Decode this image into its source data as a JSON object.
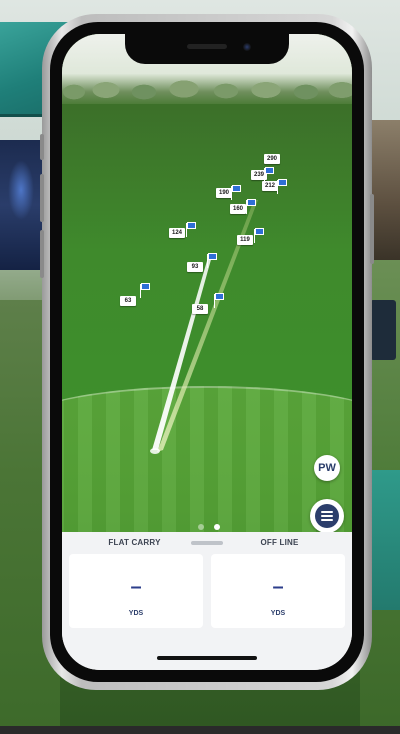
{
  "app": {
    "club_button": "PW",
    "menu_icon": "hamburger-menu-icon",
    "page_indicator": {
      "count": 2,
      "active": 1
    }
  },
  "range": {
    "target_distances": [
      {
        "label": "290"
      },
      {
        "label": "239"
      },
      {
        "label": "212"
      },
      {
        "label": "190"
      },
      {
        "label": "160"
      },
      {
        "label": "124"
      },
      {
        "label": "119"
      },
      {
        "label": "93"
      },
      {
        "label": "63"
      },
      {
        "label": "58"
      }
    ],
    "flag_color": "#2f6fd6"
  },
  "stats": {
    "left": {
      "title": "FLAT CARRY",
      "value": "–",
      "unit": "YDS"
    },
    "right": {
      "title": "OFF LINE",
      "value": "–",
      "unit": "YDS"
    }
  },
  "colors": {
    "accent": "#2c3e8b",
    "panel_bg": "#f2f3f5"
  }
}
